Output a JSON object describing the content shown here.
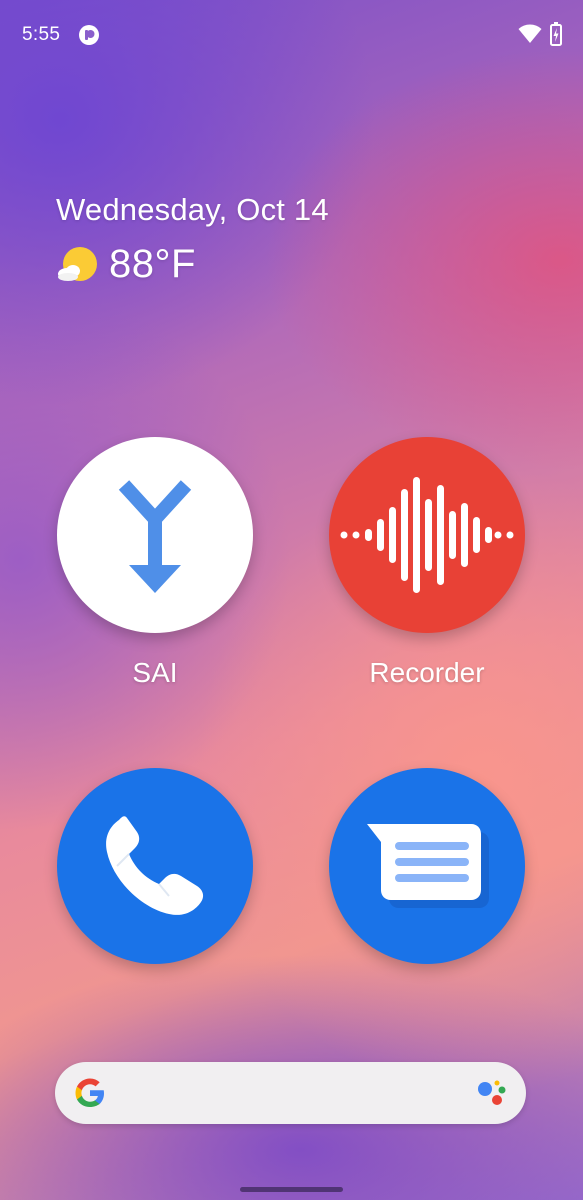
{
  "status_bar": {
    "time": "5:55",
    "app_icon": "app-notification-icon",
    "wifi_icon": "wifi-icon",
    "battery_icon": "battery-charging-icon"
  },
  "glance": {
    "date": "Wednesday, Oct 14",
    "temperature": "88°F",
    "weather_icon": "partly-sunny-icon"
  },
  "apps": [
    {
      "label": "SAI",
      "icon": "split-arrow-download-icon",
      "color": "#ffffff"
    },
    {
      "label": "Recorder",
      "icon": "sound-wave-icon",
      "color": "#e84136"
    },
    {
      "label": "",
      "icon": "phone-icon",
      "color": "#1a73e8"
    },
    {
      "label": "",
      "icon": "messages-icon",
      "color": "#1a73e8"
    }
  ],
  "search_bar": {
    "placeholder": "",
    "google_icon": "google-g-icon",
    "assistant_icon": "google-assistant-icon"
  },
  "colors": {
    "accent_blue": "#1a73e8",
    "recorder_red": "#e84136",
    "sai_blue": "#4f8fe8"
  }
}
